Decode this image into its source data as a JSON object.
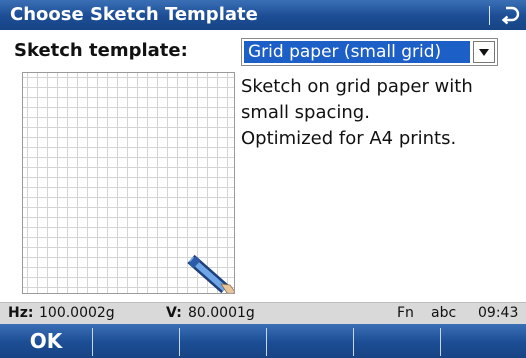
{
  "title": "Choose Sketch Template",
  "icons": {
    "back": "back-arrow-icon",
    "pencil": "pencil-icon",
    "dropdown": "chevron-down-icon"
  },
  "form": {
    "label": "Sketch template:",
    "selected": "Grid paper (small grid)"
  },
  "description": {
    "line1": "Sketch on grid paper with",
    "line2": "small spacing.",
    "line3": "Optimized for A4 prints."
  },
  "status": {
    "hz_label": "Hz:",
    "hz_value": "100.0002g",
    "v_label": "V:",
    "v_value": "80.0001g",
    "fn": "Fn",
    "input_mode": "abc",
    "time": "09:43"
  },
  "softkeys": {
    "f1": "OK"
  },
  "colors": {
    "bar": "#1c4d94",
    "selection": "#1c5fc7",
    "statusbar": "#d9d9d9"
  }
}
